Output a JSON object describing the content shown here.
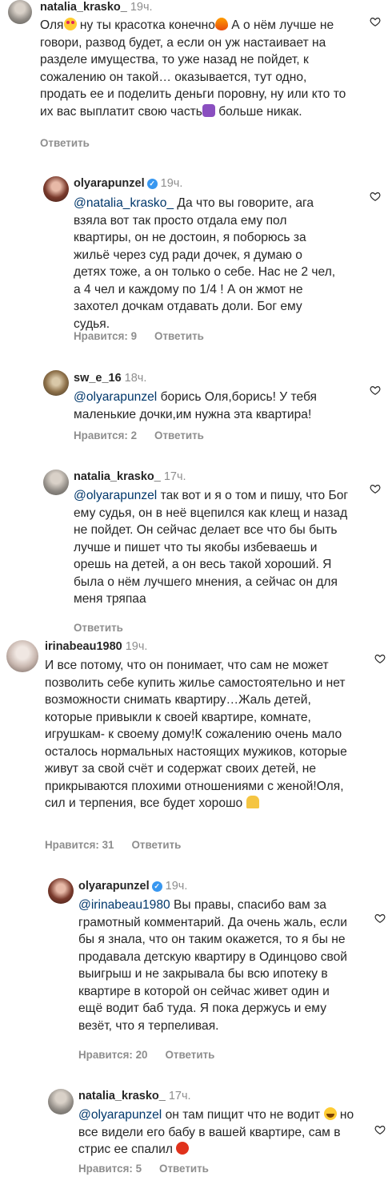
{
  "comments": [
    {
      "username": "natalia_krasko_",
      "time": "19ч.",
      "body_parts": [
        "Оля",
        " ну ты красотка конечно",
        " А о нём лучше не говори, развод будет, а если он уж настаивает на разделе имущества, то уже назад не пойдет, к сожалению он такой… оказывается, тут одно, продать ее и поделить деньги поровну, ну или кто то их вас выплатит свою часть",
        " больше никак."
      ],
      "reply_label": "Ответить"
    },
    {
      "username": "olyarapunzel",
      "verified": true,
      "time": "19ч.",
      "mention": "@natalia_krasko_",
      "text": " Да что вы говорите, ага взяла вот так просто отдала ему пол квартиры, он не достоин, я поборюсь за жильё через суд ради дочек, я думаю о детях тоже, а он только о себе. Нас не 2 чел, а 4 чел и каждому по 1/4 ! А он жмот не захотел дочкам отдавать доли. Бог ему судья.",
      "likes_label": "Нравится: 9",
      "reply_label": "Ответить"
    },
    {
      "username": "sw_e_16",
      "time": "18ч.",
      "mention": "@olyarapunzel",
      "text": " борись Оля,борись! У тебя маленькие дочки,им нужна эта квартира!",
      "likes_label": "Нравится: 2",
      "reply_label": "Ответить"
    },
    {
      "username": "natalia_krasko_",
      "time": "17ч.",
      "mention": "@olyarapunzel",
      "text": " так вот и я о том и пишу, что Бог ему судья, он в неё вцепился как клещ и назад не пойдет. Он сейчас делает все что бы быть лучше и пишет что ты якобы избеваешь и орешь на детей, а он весь такой хороший. Я была о нём лучшего мнения, а сейчас он для меня тряпаа",
      "reply_label": "Ответить"
    },
    {
      "username": "irinabeau1980",
      "time": "19ч.",
      "text": "И все потому, что он понимает, что сам не может позволить себе купить жилье самостоятельно и нет возможности снимать квартиру…Жаль детей, которые привыкли к своей квартире, комнате, игрушкам- к своему дому!К сожалению очень мало осталось нормальных настоящих мужиков, которые живут за свой счёт и содержат своих детей, не прикрываются плохими отношениями с женой!Оля, сил и  терпения, все будет хорошо",
      "likes_label": "Нравится: 31",
      "reply_label": "Ответить"
    },
    {
      "username": "olyarapunzel",
      "verified": true,
      "time": "19ч.",
      "mention": "@irinabeau1980",
      "text": " Вы правы, спасибо вам за грамотный комментарий. Да очень жаль, если бы я знала, что он таким окажется, то я бы не продавала детскую квартиру в Одинцово свой выигрыш и не закрывала бы всю ипотеку в квартире в которой он сейчас живет один и ещё водит баб туда. Я пока держусь и ему везёт, что я терпеливая.",
      "likes_label": "Нравится: 20",
      "reply_label": "Ответить"
    },
    {
      "username": "natalia_krasko_",
      "time": "17ч.",
      "mention": "@olyarapunzel",
      "text_a": " он там пищит что не водит ",
      "text_b": " но все видели его бабу в вашей квартире, сам в стрис ее спалил",
      "likes_label": "Нравится: 5",
      "reply_label": "Ответить"
    }
  ],
  "icons": {
    "heart": "heart-outline-icon",
    "verified": "verified-badge-icon"
  },
  "colors": {
    "mention": "#00376b",
    "meta": "#8e8e8e",
    "verified": "#3897f0"
  }
}
